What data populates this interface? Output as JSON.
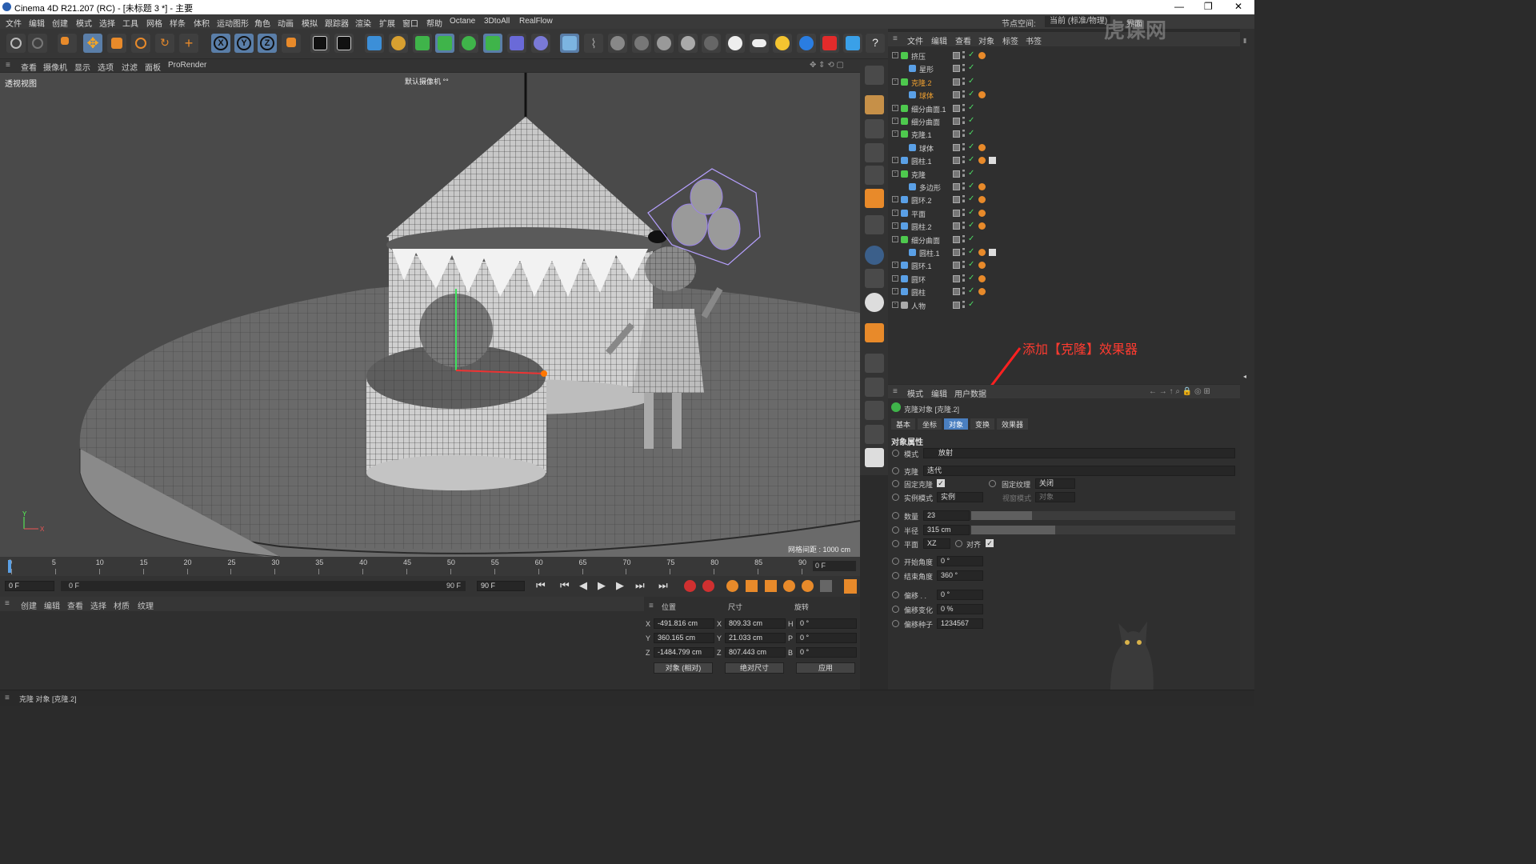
{
  "window": {
    "title": "Cinema 4D R21.207 (RC) - [未标题 3 *] - 主要",
    "controls": [
      "—",
      "❐",
      "✕"
    ]
  },
  "menu": {
    "items": [
      "文件",
      "编辑",
      "创建",
      "模式",
      "选择",
      "工具",
      "网格",
      "样条",
      "体积",
      "运动图形",
      "角色",
      "动画",
      "模拟",
      "跟踪器",
      "渲染",
      "扩展",
      "窗口",
      "帮助",
      "Octane",
      "3DtoAll",
      "RealFlow"
    ],
    "node_space_label": "节点空间:",
    "node_space_value": "当前 (标准/物理)",
    "layout_label": "界面"
  },
  "viewport_menu": {
    "items": [
      "查看",
      "摄像机",
      "显示",
      "选项",
      "过滤",
      "面板",
      "ProRender"
    ]
  },
  "viewport": {
    "name": "透视视图",
    "camera": "默认摄像机 °°",
    "grid_spacing": "网格间距 : 1000 cm",
    "axis_y": "Y",
    "axis_x": "X"
  },
  "object_manager": {
    "menu": [
      "文件",
      "编辑",
      "查看",
      "对象",
      "标签",
      "书签"
    ],
    "objects": [
      {
        "name": "挤压",
        "indent": 0,
        "icon": "extrude-icon",
        "color": "#4ec94e",
        "tags": 1
      },
      {
        "name": "星形",
        "indent": 1,
        "icon": "star-spline-icon",
        "color": "#5aa0e6",
        "tags": 0
      },
      {
        "name": "克隆.2",
        "indent": 0,
        "icon": "cloner-icon",
        "color": "#4ec94e",
        "tags": 0,
        "selected": true
      },
      {
        "name": "球体",
        "indent": 1,
        "icon": "sphere-icon",
        "color": "#5aa0e6",
        "tags": 1,
        "selected": true
      },
      {
        "name": "细分曲面.1",
        "indent": 0,
        "icon": "subdivision-icon",
        "color": "#4ec94e",
        "tags": 0
      },
      {
        "name": "细分曲面",
        "indent": 0,
        "icon": "subdivision-icon",
        "color": "#4ec94e",
        "tags": 0
      },
      {
        "name": "克隆.1",
        "indent": 0,
        "icon": "cloner-icon",
        "color": "#4ec94e",
        "tags": 0
      },
      {
        "name": "球体",
        "indent": 1,
        "icon": "sphere-icon",
        "color": "#5aa0e6",
        "tags": 1
      },
      {
        "name": "圆柱.1",
        "indent": 0,
        "icon": "cone-icon",
        "color": "#5aa0e6",
        "tags": 2
      },
      {
        "name": "克隆",
        "indent": 0,
        "icon": "cloner-icon",
        "color": "#4ec94e",
        "tags": 0
      },
      {
        "name": "多边形",
        "indent": 1,
        "icon": "polygon-icon",
        "color": "#5aa0e6",
        "tags": 1
      },
      {
        "name": "圆环.2",
        "indent": 0,
        "icon": "torus-icon",
        "color": "#5aa0e6",
        "tags": 1
      },
      {
        "name": "平面",
        "indent": 0,
        "icon": "plane-icon",
        "color": "#5aa0e6",
        "tags": 1
      },
      {
        "name": "圆柱.2",
        "indent": 0,
        "icon": "cylinder-icon",
        "color": "#5aa0e6",
        "tags": 1
      },
      {
        "name": "细分曲面",
        "indent": 0,
        "icon": "subdivision-icon",
        "color": "#4ec94e",
        "tags": 0
      },
      {
        "name": "圆柱.1",
        "indent": 1,
        "icon": "cone-icon",
        "color": "#5aa0e6",
        "tags": 2
      },
      {
        "name": "圆环.1",
        "indent": 0,
        "icon": "torus-icon",
        "color": "#5aa0e6",
        "tags": 1
      },
      {
        "name": "圆环",
        "indent": 0,
        "icon": "torus-icon",
        "color": "#5aa0e6",
        "tags": 1
      },
      {
        "name": "圆柱",
        "indent": 0,
        "icon": "cylinder-icon",
        "color": "#5aa0e6",
        "tags": 1
      },
      {
        "name": "人物",
        "indent": 0,
        "icon": "null-icon",
        "color": "#aaaaaa",
        "tags": 0
      }
    ]
  },
  "attributes": {
    "menu": [
      "模式",
      "编辑",
      "用户数据"
    ],
    "object_title": "克隆对象 [克隆.2]",
    "tabs": [
      "基本",
      "坐标",
      "对象",
      "变换",
      "效果器"
    ],
    "active_tab": 2,
    "section": "对象属性",
    "rows": {
      "mode_label": "模式",
      "mode_value": "放射",
      "clones_label": "克隆",
      "clones_value": "迭代",
      "fixed_clone_label": "固定克隆",
      "fixed_texture_label": "固定纹理",
      "fixed_texture_value": "关闭",
      "instance_mode_label": "实例模式",
      "instance_mode_value": "实例",
      "viewport_mode_label": "视窗模式",
      "viewport_mode_value": "对象",
      "count_label": "数量",
      "count_value": "23",
      "radius_label": "半径",
      "radius_value": "315 cm",
      "plane_label": "平面",
      "plane_value": "XZ",
      "align_label": "对齐",
      "start_angle_label": "开始角度",
      "start_angle_value": "0 °",
      "end_angle_label": "结束角度",
      "end_angle_value": "360 °",
      "offset_label": "偏移 . .",
      "offset_value": "0 °",
      "offset_var_label": "偏移变化",
      "offset_var_value": "0 %",
      "offset_seed_label": "偏移种子",
      "offset_seed_value": "1234567"
    }
  },
  "timeline": {
    "ticks": [
      "0",
      "5",
      "10",
      "15",
      "20",
      "25",
      "30",
      "35",
      "40",
      "45",
      "50",
      "55",
      "60",
      "65",
      "70",
      "75",
      "80",
      "85",
      "90"
    ],
    "current_frame": "0 F",
    "frame_end_field": "0 F",
    "start_field": "0 F",
    "range_start": "0 F",
    "range_end": "90 F",
    "max_field": "90 F"
  },
  "material_panel": {
    "menu": [
      "创建",
      "编辑",
      "查看",
      "选择",
      "材质",
      "纹理"
    ]
  },
  "coords": {
    "headers": [
      "位置",
      "尺寸",
      "旋转"
    ],
    "pos": {
      "x": "-491.816 cm",
      "y": "360.165 cm",
      "z": "-1484.799 cm"
    },
    "size": {
      "x": "809.33 cm",
      "y": "21.033 cm",
      "z": "807.443 cm"
    },
    "rot": {
      "h": "0 °",
      "p": "0 °",
      "b": "0 °"
    },
    "labels": {
      "x": "X",
      "y": "Y",
      "z": "Z",
      "h": "H",
      "p": "P",
      "b": "B"
    },
    "mode_a": "对象 (相对)",
    "mode_b": "绝对尺寸",
    "apply": "应用"
  },
  "status": "克隆 对象 [克隆.2]",
  "annotation": "添加【克隆】效果器",
  "watermark": "虎课网"
}
